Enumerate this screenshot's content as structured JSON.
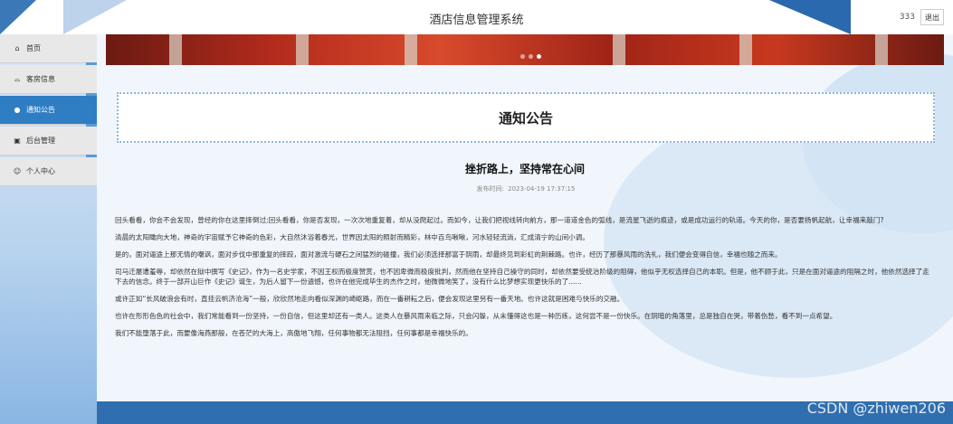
{
  "header": {
    "title": "酒店信息管理系统",
    "username": "333",
    "logout_label": "退出"
  },
  "sidebar": {
    "items": [
      {
        "label": "首页",
        "icon": "home-icon",
        "active": false
      },
      {
        "label": "客房信息",
        "icon": "lock-icon",
        "active": false
      },
      {
        "label": "通知公告",
        "icon": "dot-icon",
        "active": true
      },
      {
        "label": "后台管理",
        "icon": "calendar-icon",
        "active": false
      },
      {
        "label": "个人中心",
        "icon": "user-icon",
        "active": false
      }
    ]
  },
  "notice": {
    "heading": "通知公告"
  },
  "article": {
    "title": "挫折路上，坚持常在心间",
    "time_label": "发布时间:",
    "time_value": "2023-04-19 17:37:15",
    "paragraphs": [
      "回头看看，你会不会发现，曾经的你在这里摔倒过;回头看看，你是否发现，一次次地重复着，却从没爬起过。而如今，让我们把视线转向前方，那一道道金色的弧线，是流星飞逝的痕迹，或是成功运行的轨道。今天的你，是否要扬帆起航，让幸福来敲门?",
      "清晨的太阳瞰向大地，神奇的宇宙赋予它神奇的色彩，大自然沐浴着春光，世界因太阳的照射而精彩，林中百鸟啾啾，河水轻轻流淌，汇成清宁的山间小调。",
      "是的，面对逼途上那无情的嘲讽，面对步伐中那重复的摔跤，面对激流与硬石之间猛烈的碰撞，我们必须选择那富于阴雨，却最终见到彩虹的荆棘路。也许，经历了那暴风雨的洗礼，我们便会变得自信，幸福也随之而来。",
      "司马迁屡遭羞辱，却依然在狱中撰写《史记》，作为一名史学家，不因王权而极度赞赏，也不因卑微而极度批判，然而他在坚持自己操守的同时，却依然要受统治阶级的阻碍，他似乎无权选择自己的本职。但是，他不顾于此，只是在面对逼途的阻隔之时，他依然选择了走下去的信念。终于一部开山巨作《史记》诞生，为后人留下一份遗憾，也许在他完成毕生的杰作之时，他微微地笑了，没有什么比梦想实现更快乐的了......",
      "或许正如“长风破浪会有时，直挂云帆济沧海”一般，欣欣然地走向看似深渊的崎岖路，而在一番耕耘之后，便会发现这里另有一番天地。也许这就是困难与快乐的交融。",
      "也许在形形色色的社会中，我们常能看到一份坚持，一份自信，但这里却还有一类人。这类人在暴风雨来临之际，只会闪躲，从未懂得这也是一种历练，这何尝不是一份快乐。在阴暗的角落里，总是独自在哭，带着伤愁，看不到一点希望。",
      "我们不能堕落于此，而要像海燕那般，在苍茫的大海上，高傲地飞翔，任何事物都无法阻挡，任何事都是幸福快乐的。"
    ]
  },
  "banner": {
    "dots": [
      false,
      false,
      true
    ]
  },
  "watermark": "CSDN @zhiwen206",
  "colors": {
    "accent": "#2f7dc2",
    "header_shape": "#3b78b8",
    "footer": "#2f6fb0"
  }
}
